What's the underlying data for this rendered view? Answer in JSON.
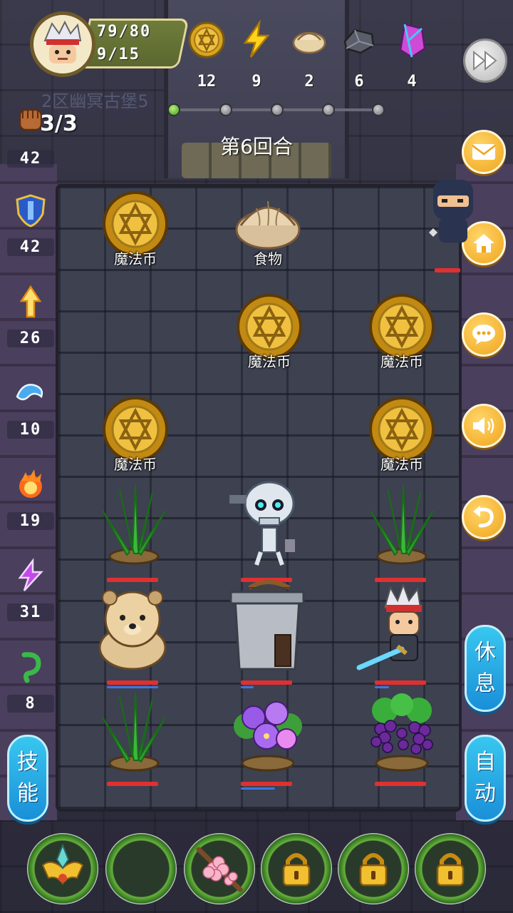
{
  "player": {
    "hp": "79/80",
    "energy": "9/15"
  },
  "resources": [
    {
      "name": "magic-coin",
      "value": "12"
    },
    {
      "name": "lightning",
      "value": "9"
    },
    {
      "name": "food",
      "value": "2"
    },
    {
      "name": "ore",
      "value": "6"
    },
    {
      "name": "gem",
      "value": "4"
    }
  ],
  "zone": "2区幽冥古堡5",
  "round": "第6回合",
  "progress": {
    "total_steps": 5,
    "current_step": 1
  },
  "attack_count": "3/3",
  "left_stats": [
    {
      "name": "attack-fist-icon",
      "value": "42"
    },
    {
      "name": "shield-icon",
      "value": "42"
    },
    {
      "name": "holy-arrow-icon",
      "value": "26"
    },
    {
      "name": "water-icon",
      "value": "10"
    },
    {
      "name": "fire-icon",
      "value": "19"
    },
    {
      "name": "lightning-icon",
      "value": "31"
    },
    {
      "name": "poison-icon",
      "value": "8"
    }
  ],
  "board": {
    "labels": {
      "coin": "魔法币",
      "food": "食物"
    }
  },
  "buttons": {
    "rest_1": "休",
    "rest_2": "息",
    "auto_1": "自",
    "auto_2": "动",
    "skill_1": "技",
    "skill_2": "能"
  },
  "colors": {
    "accent": "#f0a41c",
    "blue_button": "#1a8fd8",
    "hp_bar": "#e03030"
  }
}
